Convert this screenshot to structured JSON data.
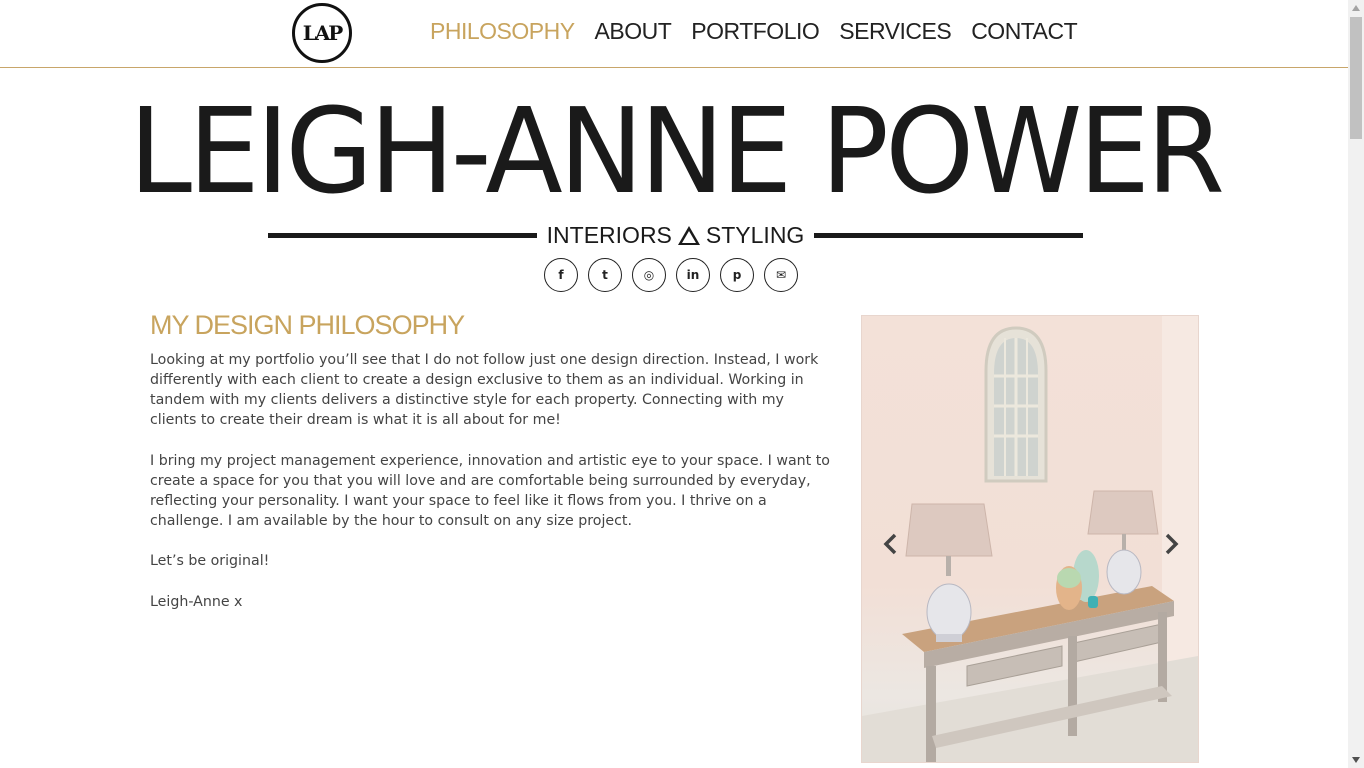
{
  "header": {
    "logo_text": "LAP",
    "nav": [
      {
        "label": "Philosophy",
        "active": true
      },
      {
        "label": "About",
        "active": false
      },
      {
        "label": "Portfolio",
        "active": false
      },
      {
        "label": "Services",
        "active": false
      },
      {
        "label": "Contact",
        "active": false
      }
    ]
  },
  "brand": {
    "title": "LEIGH-ANNE POWER",
    "subtitle_left": "INTERIORS",
    "subtitle_right": "STYLING"
  },
  "social": [
    {
      "icon": "facebook-icon",
      "glyph": "f"
    },
    {
      "icon": "twitter-icon",
      "glyph": "t"
    },
    {
      "icon": "instagram-icon",
      "glyph": "◎"
    },
    {
      "icon": "linkedin-icon",
      "glyph": "in"
    },
    {
      "icon": "pinterest-icon",
      "glyph": "p"
    },
    {
      "icon": "email-icon",
      "glyph": "✉"
    }
  ],
  "main": {
    "heading": "MY DESIGN PHILOSOPHY",
    "paragraphs": [
      "Looking at my portfolio you’ll see that I do not follow just one design direction. Instead, I work differently with each client to create a design exclusive to them as an individual. Working in tandem with my clients delivers a distinctive style for each property. Connecting with my clients to create their dream is what it is all about for me!",
      "I bring my project management experience, innovation and artistic eye to your space. I want to create a space for you that you will love and are comfortable being surrounded by everyday, reflecting your personality. I want your space to feel like it flows from you. I thrive on a challenge. I am available by the hour to consult on any size project.",
      "Let’s be original!",
      "Leigh-Anne x"
    ]
  },
  "colors": {
    "accent": "#c8a45e",
    "text": "#444444",
    "dark": "#1a1a1a"
  }
}
